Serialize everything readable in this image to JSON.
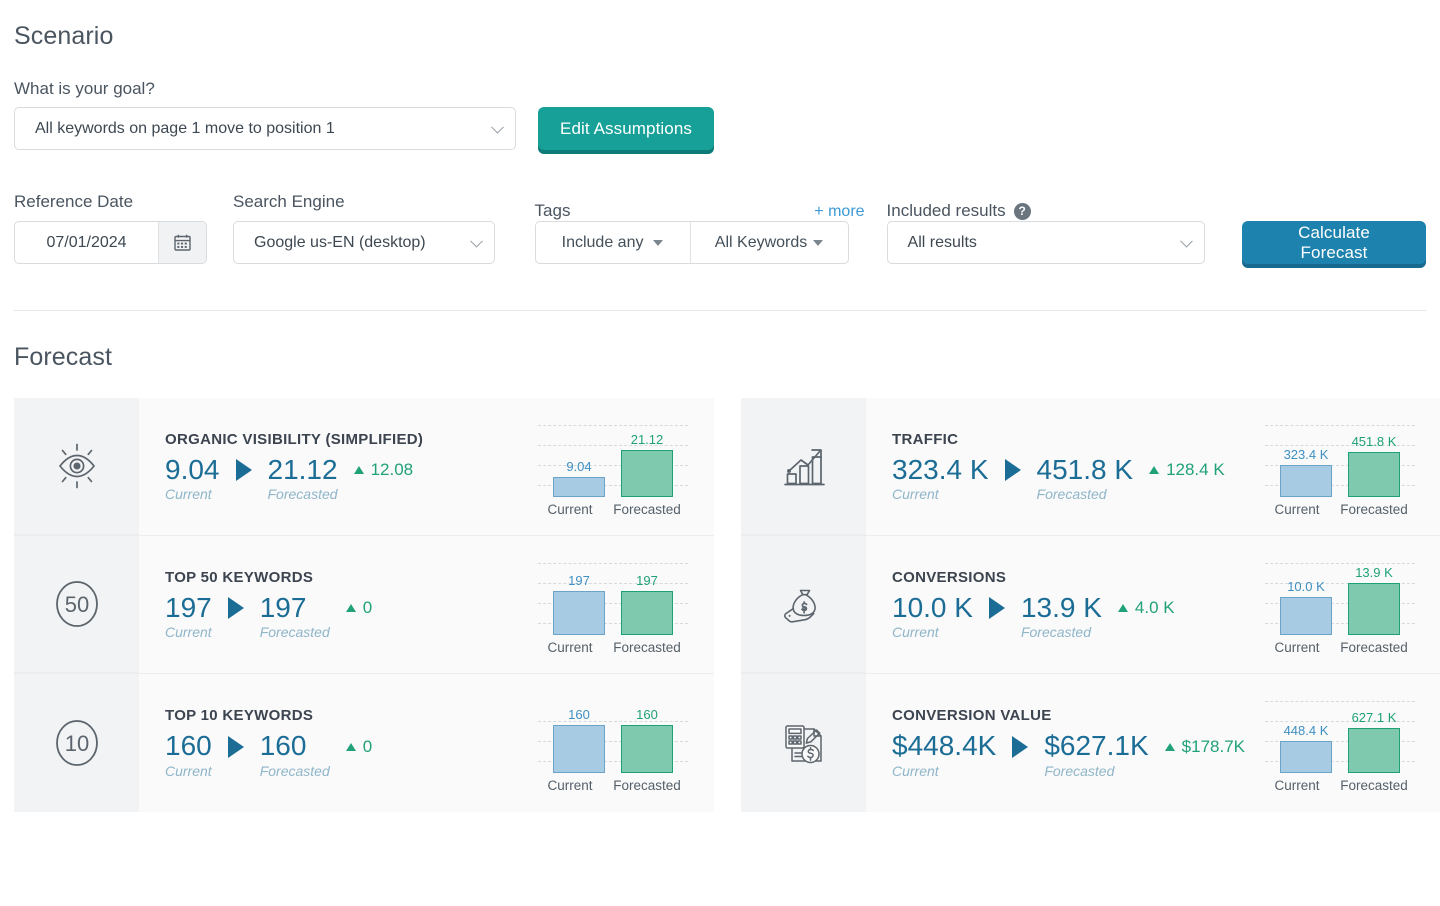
{
  "scenario": {
    "title": "Scenario",
    "goal_label": "What is your goal?",
    "goal_value": "All keywords on page 1 move to position 1",
    "edit_assumptions_label": "Edit Assumptions"
  },
  "filters": {
    "reference_date": {
      "label": "Reference Date",
      "value": "07/01/2024",
      "icon": "calendar-icon"
    },
    "search_engine": {
      "label": "Search Engine",
      "value": "Google us-EN (desktop)"
    },
    "tags": {
      "label": "Tags",
      "more_label": "+ more",
      "mode_value": "Include any",
      "scope_value": "All Keywords"
    },
    "included_results": {
      "label": "Included results",
      "help_icon": "question-mark-icon",
      "value": "All results"
    },
    "calculate_label": "Calculate Forecast"
  },
  "forecast": {
    "title": "Forecast",
    "axis": {
      "current": "Current",
      "forecasted": "Forecasted"
    },
    "cards": [
      {
        "icon": "eye-icon",
        "title": "ORGANIC VISIBILITY (SIMPLIFIED)",
        "current": "9.04",
        "forecasted": "21.12",
        "delta": "12.08",
        "current_caption": "Current",
        "forecasted_caption": "Forecasted",
        "chart_current_label": "9.04",
        "chart_forecast_label": "21.12"
      },
      {
        "icon": "circle-50-icon",
        "title": "TOP 50 KEYWORDS",
        "current": "197",
        "forecasted": "197",
        "delta": "0",
        "current_caption": "Current",
        "forecasted_caption": "Forecasted",
        "chart_current_label": "197",
        "chart_forecast_label": "197"
      },
      {
        "icon": "circle-10-icon",
        "title": "TOP 10 KEYWORDS",
        "current": "160",
        "forecasted": "160",
        "delta": "0",
        "current_caption": "Current",
        "forecasted_caption": "Forecasted",
        "chart_current_label": "160",
        "chart_forecast_label": "160"
      },
      {
        "icon": "bar-chart-growth-icon",
        "title": "TRAFFIC",
        "current": "323.4 K",
        "forecasted": "451.8 K",
        "delta": "128.4 K",
        "current_caption": "Current",
        "forecasted_caption": "Forecasted",
        "chart_current_label": "323.4 K",
        "chart_forecast_label": "451.8 K"
      },
      {
        "icon": "money-bag-hand-icon",
        "title": "CONVERSIONS",
        "current": "10.0 K",
        "forecasted": "13.9 K",
        "delta": "4.0 K",
        "current_caption": "Current",
        "forecasted_caption": "Forecasted",
        "chart_current_label": "10.0 K",
        "chart_forecast_label": "13.9 K"
      },
      {
        "icon": "invoice-calculator-icon",
        "title": "CONVERSION VALUE",
        "current": "$448.4K",
        "forecasted": "$627.1K",
        "delta": "$178.7K",
        "current_caption": "Current",
        "forecasted_caption": "Forecasted",
        "chart_current_label": "448.4 K",
        "chart_forecast_label": "627.1 K"
      }
    ]
  },
  "chart_data": [
    {
      "type": "bar",
      "title": "ORGANIC VISIBILITY (SIMPLIFIED)",
      "categories": [
        "Current",
        "Forecasted"
      ],
      "values": [
        9.04,
        21.12
      ],
      "ylim": [
        0,
        23.2
      ],
      "grid": true,
      "colors": {
        "current": "#a8cbe4",
        "forecasted": "#7fc9ae"
      }
    },
    {
      "type": "bar",
      "title": "TOP 50 KEYWORDS",
      "categories": [
        "Current",
        "Forecasted"
      ],
      "values": [
        197,
        197
      ],
      "ylim": [
        0,
        217
      ],
      "grid": true,
      "colors": {
        "current": "#a8cbe4",
        "forecasted": "#7fc9ae"
      }
    },
    {
      "type": "bar",
      "title": "TOP 10 KEYWORDS",
      "categories": [
        "Current",
        "Forecasted"
      ],
      "values": [
        160,
        160
      ],
      "ylim": [
        0,
        176
      ],
      "grid": true,
      "colors": {
        "current": "#a8cbe4",
        "forecasted": "#7fc9ae"
      }
    },
    {
      "type": "bar",
      "title": "TRAFFIC",
      "categories": [
        "Current",
        "Forecasted"
      ],
      "values": [
        323400,
        451800
      ],
      "ylim": [
        0,
        497000
      ],
      "grid": true,
      "colors": {
        "current": "#a8cbe4",
        "forecasted": "#7fc9ae"
      }
    },
    {
      "type": "bar",
      "title": "CONVERSIONS",
      "categories": [
        "Current",
        "Forecasted"
      ],
      "values": [
        10000,
        13900
      ],
      "ylim": [
        0,
        15300
      ],
      "grid": true,
      "colors": {
        "current": "#a8cbe4",
        "forecasted": "#7fc9ae"
      }
    },
    {
      "type": "bar",
      "title": "CONVERSION VALUE",
      "categories": [
        "Current",
        "Forecasted"
      ],
      "values": [
        448400,
        627100
      ],
      "ylim": [
        0,
        690000
      ],
      "grid": true,
      "colors": {
        "current": "#a8cbe4",
        "forecasted": "#7fc9ae"
      }
    }
  ],
  "theme": {
    "teal": "#16a098",
    "blue": "#1d82ad",
    "value_blue": "#1b6d96",
    "delta_green": "#21a179",
    "link_blue": "#3d9ad4"
  }
}
